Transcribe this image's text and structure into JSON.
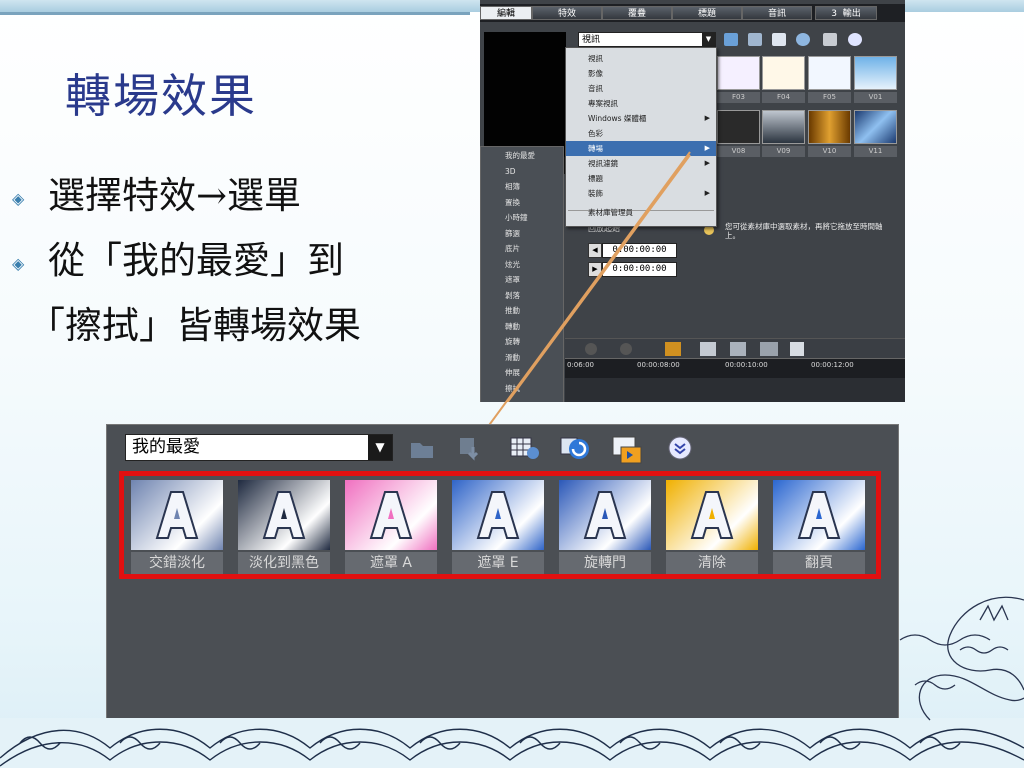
{
  "slide": {
    "title": "轉場效果",
    "bullets": [
      "選擇特效→選單",
      "從「我的最愛」到"
    ],
    "continuation": "「擦拭」皆轉場效果"
  },
  "screenshot1": {
    "tabs": [
      "編輯",
      "特效",
      "覆疊",
      "標題",
      "音訊",
      "3",
      "輸出"
    ],
    "combo_value": "視訊",
    "menu_items": [
      {
        "label": "視訊",
        "submenu": false
      },
      {
        "label": "影像",
        "submenu": false
      },
      {
        "label": "音訊",
        "submenu": false
      },
      {
        "label": "專案視訊",
        "submenu": false
      },
      {
        "label": "Windows 媒體櫃",
        "submenu": true
      },
      {
        "label": "色彩",
        "submenu": false
      },
      {
        "label": "轉場",
        "submenu": true
      },
      {
        "label": "視訊濾鏡",
        "submenu": true
      },
      {
        "label": "標題",
        "submenu": false
      },
      {
        "label": "裝飾",
        "submenu": true
      },
      {
        "label": "素材庫管理員",
        "submenu": false
      }
    ],
    "selected_menu_item": "轉場",
    "submenu_items": [
      "我的最愛",
      "3D",
      "相簿",
      "置換",
      "小時鐘",
      "篩選",
      "底片",
      "炫光",
      "遮罩",
      "剝落",
      "推動",
      "轉動",
      "旋轉",
      "滑動",
      "伸展",
      "擦拭"
    ],
    "thumb_captions": [
      "F03",
      "F04",
      "F05",
      "V01",
      "V08",
      "V09",
      "V10",
      "V11"
    ],
    "hint_text": "您可從素材庫中選取素材，再將它拖放至時間軸上。",
    "hint_partial": "回放起始",
    "time_values": [
      "0:00:00:00",
      "0:00:00:00"
    ],
    "ruler_ticks": [
      "0:06:00",
      "00:00:08:00",
      "00:00:10:00",
      "00:00:12:00"
    ]
  },
  "screenshot2": {
    "combo_value": "我的最愛",
    "effects": [
      {
        "label": "交錯淡化",
        "bg": "#6f84b0"
      },
      {
        "label": "淡化到黑色",
        "bg": "#1f2a40"
      },
      {
        "label": "遮罩 A",
        "bg": "#f070c0"
      },
      {
        "label": "遮罩 E",
        "bg": "#2f64c8"
      },
      {
        "label": "旋轉門",
        "bg": "#2b58b8"
      },
      {
        "label": "清除",
        "bg": "#f0b000"
      },
      {
        "label": "翻頁",
        "bg": "#2a66d0"
      }
    ]
  },
  "icons": [
    "folder-icon",
    "import-icon",
    "grid-view-icon",
    "refresh-icon",
    "storyboard-icon",
    "expand-icon"
  ],
  "colors": {
    "title": "#2a3a8c",
    "highlight_frame": "#e01010",
    "arrow": "#e0a060"
  }
}
